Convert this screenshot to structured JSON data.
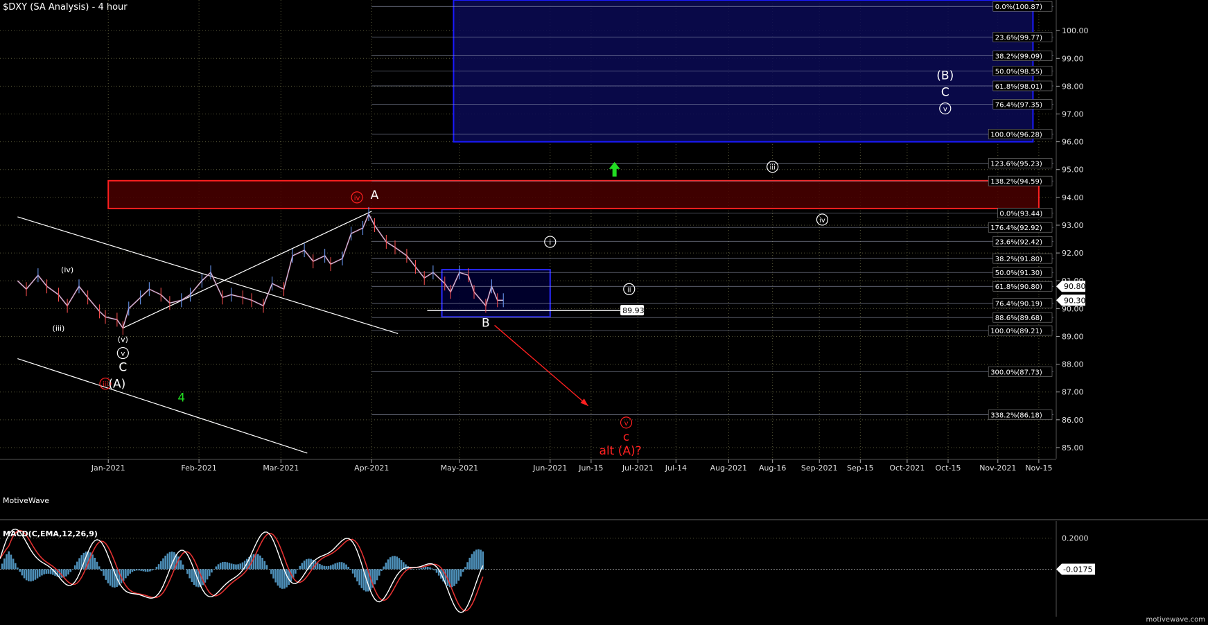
{
  "window": {
    "title": "$DXY (SA Analysis) - 4 hour",
    "brand": "MotiveWave",
    "watermark": "motivewave.com"
  },
  "chart_data": [
    {
      "type": "line",
      "title": "$DXY (SA Analysis) - 4 hour",
      "price_axis": {
        "ticks": [
          85.0,
          86.0,
          87.0,
          88.0,
          89.0,
          90.0,
          91.0,
          92.0,
          93.0,
          94.0,
          95.0,
          96.0,
          97.0,
          98.0,
          99.0,
          100.0
        ],
        "labels": [
          "85.00",
          "86.00",
          "87.00",
          "88.00",
          "89.00",
          "90.00",
          "91.00",
          "92.00",
          "93.00",
          "94.00",
          "95.00",
          "96.00",
          "97.00",
          "98.00",
          "99.00",
          "100.00"
        ],
        "ylim": [
          84.6,
          101.1
        ],
        "current_price_badges": [
          {
            "value": 90.8,
            "label": "90.80"
          },
          {
            "value": 90.3,
            "label": "90.30"
          }
        ]
      },
      "time_axis": {
        "labels": [
          "Jan-2021",
          "Feb-2021",
          "Mar-2021",
          "Apr-2021",
          "May-2021",
          "Jun-2021",
          "Jun-15",
          "Jul-2021",
          "Jul-14",
          "Aug-2021",
          "Aug-16",
          "Sep-2021",
          "Sep-15",
          "Oct-2021",
          "Oct-15",
          "Nov-2021",
          "Nov-15"
        ],
        "dates": [
          "2021-01-01",
          "2021-02-01",
          "2021-03-01",
          "2021-04-01",
          "2021-05-01",
          "2021-06-01",
          "2021-06-15",
          "2021-07-01",
          "2021-07-14",
          "2021-08-01",
          "2021-08-16",
          "2021-09-01",
          "2021-09-15",
          "2021-10-01",
          "2021-10-15",
          "2021-11-01",
          "2021-11-15"
        ]
      },
      "series": [
        {
          "values": [
            [
              "2020-12-01",
              91.0
            ],
            [
              "2020-12-04",
              90.7
            ],
            [
              "2020-12-08",
              91.2
            ],
            [
              "2020-12-11",
              90.8
            ],
            [
              "2020-12-15",
              90.5
            ],
            [
              "2020-12-18",
              90.1
            ],
            [
              "2020-12-22",
              90.8
            ],
            [
              "2020-12-25",
              90.4
            ],
            [
              "2020-12-29",
              89.9
            ],
            [
              "2020-12-31",
              89.7
            ],
            [
              "2021-01-04",
              89.6
            ],
            [
              "2021-01-06",
              89.3
            ],
            [
              "2021-01-08",
              90.0
            ],
            [
              "2021-01-12",
              90.4
            ],
            [
              "2021-01-15",
              90.7
            ],
            [
              "2021-01-19",
              90.5
            ],
            [
              "2021-01-22",
              90.2
            ],
            [
              "2021-01-26",
              90.3
            ],
            [
              "2021-01-29",
              90.5
            ],
            [
              "2021-02-02",
              91.0
            ],
            [
              "2021-02-05",
              91.3
            ],
            [
              "2021-02-09",
              90.4
            ],
            [
              "2021-02-12",
              90.5
            ],
            [
              "2021-02-16",
              90.4
            ],
            [
              "2021-02-19",
              90.3
            ],
            [
              "2021-02-23",
              90.1
            ],
            [
              "2021-02-26",
              90.9
            ],
            [
              "2021-03-02",
              90.7
            ],
            [
              "2021-03-05",
              91.9
            ],
            [
              "2021-03-09",
              92.1
            ],
            [
              "2021-03-12",
              91.7
            ],
            [
              "2021-03-16",
              91.9
            ],
            [
              "2021-03-18",
              91.6
            ],
            [
              "2021-03-22",
              91.8
            ],
            [
              "2021-03-25",
              92.7
            ],
            [
              "2021-03-29",
              92.9
            ],
            [
              "2021-03-31",
              93.4
            ],
            [
              "2021-04-02",
              93.0
            ],
            [
              "2021-04-06",
              92.4
            ],
            [
              "2021-04-09",
              92.2
            ],
            [
              "2021-04-13",
              91.9
            ],
            [
              "2021-04-16",
              91.5
            ],
            [
              "2021-04-19",
              91.1
            ],
            [
              "2021-04-22",
              91.3
            ],
            [
              "2021-04-26",
              90.9
            ],
            [
              "2021-04-28",
              90.6
            ],
            [
              "2021-05-01",
              91.3
            ],
            [
              "2021-05-04",
              91.2
            ],
            [
              "2021-05-06",
              90.6
            ],
            [
              "2021-05-10",
              90.1
            ],
            [
              "2021-05-12",
              90.8
            ],
            [
              "2021-05-14",
              90.3
            ],
            [
              "2021-05-16",
              90.3
            ]
          ]
        }
      ],
      "channel_lines": [
        {
          "from": [
            "2020-12-01",
            93.3
          ],
          "to": [
            "2021-04-10",
            89.1
          ]
        },
        {
          "from": [
            "2020-12-01",
            88.2
          ],
          "to": [
            "2021-03-10",
            84.8
          ]
        },
        {
          "from": [
            "2021-01-06",
            89.3
          ],
          "to": [
            "2021-04-01",
            93.5
          ]
        }
      ],
      "zones": [
        {
          "name": "target-box-blue",
          "from": "2021-04-29",
          "to": "2021-11-13",
          "low": 96.0,
          "high": 101.1,
          "fill": "#0b0b55",
          "stroke": "#1a1aff"
        },
        {
          "name": "resistance-box-red",
          "from": "2021-01-01",
          "to": "2021-11-15",
          "low": 93.6,
          "high": 94.6,
          "fill": "#4a0000",
          "stroke": "#ff2020"
        },
        {
          "name": "support-box-blue",
          "from": "2021-04-25",
          "to": "2021-06-01",
          "low": 89.7,
          "high": 91.4,
          "fill": "#000033",
          "stroke": "#2a2aff"
        }
      ],
      "fib_levels": [
        {
          "label": "0.0%(100.87)",
          "value": 100.87,
          "from": "2021-04-01"
        },
        {
          "label": "23.6%(99.77)",
          "value": 99.77,
          "from": "2021-04-01"
        },
        {
          "label": "38.2%(99.09)",
          "value": 99.09,
          "from": "2021-04-01"
        },
        {
          "label": "50.0%(98.55)",
          "value": 98.55,
          "from": "2021-04-01"
        },
        {
          "label": "61.8%(98.01)",
          "value": 98.01,
          "from": "2021-04-01"
        },
        {
          "label": "76.4%(97.35)",
          "value": 97.35,
          "from": "2021-04-01"
        },
        {
          "label": "100.0%(96.28)",
          "value": 96.28,
          "from": "2021-04-01"
        },
        {
          "label": "123.6%(95.23)",
          "value": 95.23,
          "from": "2021-04-01"
        },
        {
          "label": "138.2%(94.59)",
          "value": 94.59,
          "from": "2021-04-01"
        },
        {
          "label": "0.0%(93.44)",
          "value": 93.44,
          "from": "2021-04-01"
        },
        {
          "label": "176.4%(92.92)",
          "value": 92.92,
          "from": "2021-04-01"
        },
        {
          "label": "23.6%(92.42)",
          "value": 92.42,
          "from": "2021-04-01"
        },
        {
          "label": "38.2%(91.80)",
          "value": 91.8,
          "from": "2021-04-01"
        },
        {
          "label": "50.0%(91.30)",
          "value": 91.3,
          "from": "2021-04-01"
        },
        {
          "label": "61.8%(90.80)",
          "value": 90.8,
          "from": "2021-04-01"
        },
        {
          "label": "76.4%(90.19)",
          "value": 90.19,
          "from": "2021-04-01"
        },
        {
          "label": "88.6%(89.68)",
          "value": 89.68,
          "from": "2021-04-01"
        },
        {
          "label": "100.0%(89.21)",
          "value": 89.21,
          "from": "2021-04-01"
        },
        {
          "label": "300.0%(87.73)",
          "value": 87.73,
          "from": "2021-04-01"
        },
        {
          "label": "338.2%(86.18)",
          "value": 86.18,
          "from": "2021-04-01"
        }
      ],
      "price_marker": {
        "label": "89.93",
        "value": 89.93,
        "from": "2021-04-20",
        "to": "2021-06-25"
      },
      "wave_labels": [
        {
          "text": "(B)",
          "date": "2021-10-14",
          "price": 98.4,
          "color": "#ffffff",
          "style": "plain"
        },
        {
          "text": "C",
          "date": "2021-10-14",
          "price": 97.8,
          "color": "#ffffff",
          "style": "plain"
        },
        {
          "text": "v",
          "date": "2021-10-14",
          "price": 97.2,
          "color": "#ffffff",
          "style": "circle"
        },
        {
          "text": "iii",
          "date": "2021-08-16",
          "price": 95.1,
          "color": "#ffffff",
          "style": "circle"
        },
        {
          "text": "iv",
          "date": "2021-09-02",
          "price": 93.2,
          "color": "#ffffff",
          "style": "circle"
        },
        {
          "text": "i",
          "date": "2021-06-01",
          "price": 92.4,
          "color": "#ffffff",
          "style": "circle"
        },
        {
          "text": "ii",
          "date": "2021-06-28",
          "price": 90.7,
          "color": "#ffffff",
          "style": "circle"
        },
        {
          "text": "iv",
          "date": "2021-03-27",
          "price": 94.0,
          "color": "#ff2020",
          "style": "circle"
        },
        {
          "text": "A",
          "date": "2021-04-02",
          "price": 94.1,
          "color": "#ffffff",
          "style": "plain"
        },
        {
          "text": "B",
          "date": "2021-05-10",
          "price": 89.5,
          "color": "#ffffff",
          "style": "plain"
        },
        {
          "text": "(iv)",
          "date": "2020-12-18",
          "price": 91.4,
          "color": "#ffffff",
          "style": "small"
        },
        {
          "text": "(iii)",
          "date": "2020-12-15",
          "price": 89.3,
          "color": "#ffffff",
          "style": "small"
        },
        {
          "text": "(v)",
          "date": "2021-01-06",
          "price": 88.9,
          "color": "#ffffff",
          "style": "small"
        },
        {
          "text": "v",
          "date": "2021-01-06",
          "price": 88.4,
          "color": "#ffffff",
          "style": "circle"
        },
        {
          "text": "C",
          "date": "2021-01-06",
          "price": 87.9,
          "color": "#ffffff",
          "style": "plain"
        },
        {
          "text": "iii",
          "date": "2020-12-31",
          "price": 87.3,
          "color": "#ff2020",
          "style": "circle"
        },
        {
          "text": "(A)",
          "date": "2021-01-04",
          "price": 87.3,
          "color": "#ffffff",
          "style": "plain"
        },
        {
          "text": "4",
          "date": "2021-01-26",
          "price": 86.8,
          "color": "#22dd22",
          "style": "plain"
        },
        {
          "text": "v",
          "date": "2021-06-27",
          "price": 85.9,
          "color": "#ff2020",
          "style": "circle"
        },
        {
          "text": "c",
          "date": "2021-06-27",
          "price": 85.4,
          "color": "#ff2020",
          "style": "plain"
        },
        {
          "text": "alt (A)?",
          "date": "2021-06-25",
          "price": 84.9,
          "color": "#ff2020",
          "style": "plain"
        }
      ],
      "arrows": [
        {
          "name": "up-arrow",
          "date": "2021-06-23",
          "price": 95.0,
          "direction": "up",
          "color": "#22dd22"
        },
        {
          "name": "down-arrow",
          "from": [
            "2021-05-13",
            89.4
          ],
          "to": [
            "2021-06-14",
            86.5
          ],
          "color": "#ff2020"
        }
      ]
    },
    {
      "type": "line",
      "title": "MACD(C,EMA,12,26,9)",
      "axis": {
        "ticks": [
          0.2,
          -0.0175
        ],
        "labels": [
          "0.2000",
          "-0.0175"
        ],
        "ylim": [
          -0.35,
          0.32
        ]
      },
      "zero_line": -0.0175
    }
  ]
}
